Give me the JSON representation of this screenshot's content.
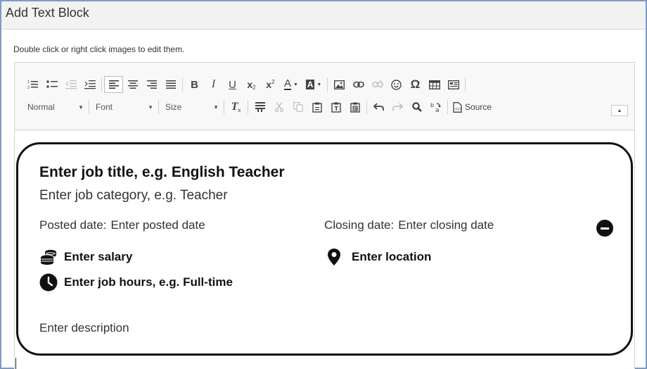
{
  "dialog": {
    "title": "Add Text Block",
    "hint": "Double click or right click images to edit them."
  },
  "toolbar": {
    "row1": [
      {
        "name": "numbered-list-icon",
        "label": "Insert/Remove Numbered List"
      },
      {
        "name": "bulleted-list-icon",
        "label": "Insert/Remove Bulleted List"
      },
      {
        "name": "decrease-indent-icon",
        "label": "Decrease Indent",
        "disabled": true
      },
      {
        "name": "increase-indent-icon",
        "label": "Increase Indent"
      },
      {
        "name": "align-left-icon",
        "label": "Align Left",
        "active": true
      },
      {
        "name": "align-center-icon",
        "label": "Center"
      },
      {
        "name": "align-right-icon",
        "label": "Align Right"
      },
      {
        "name": "justify-icon",
        "label": "Justify"
      },
      {
        "name": "bold-icon",
        "glyph": "B"
      },
      {
        "name": "italic-icon",
        "glyph": "I"
      },
      {
        "name": "underline-icon",
        "glyph": "U"
      },
      {
        "name": "subscript-icon",
        "glyph": "x"
      },
      {
        "name": "superscript-icon",
        "glyph": "x"
      },
      {
        "name": "text-color-icon",
        "glyph": "A"
      },
      {
        "name": "background-color-icon",
        "glyph": "A"
      },
      {
        "name": "image-icon"
      },
      {
        "name": "link-icon"
      },
      {
        "name": "unlink-icon",
        "disabled": true
      },
      {
        "name": "smiley-icon"
      },
      {
        "name": "omega-icon",
        "glyph": "Ω"
      },
      {
        "name": "table-icon"
      },
      {
        "name": "template-icon"
      }
    ],
    "format_combo": "Normal",
    "font_combo": "Font",
    "size_combo": "Size",
    "source_label": "Source",
    "colors": {
      "toolbar_bg": "#f8f8f8",
      "icon": "#444444",
      "icon_disabled": "#c0c0c0",
      "window_border": "#7a9cc6"
    }
  },
  "card": {
    "job_title": "Enter job title, e.g. English Teacher",
    "job_category": "Enter job category, e.g. Teacher",
    "posted_label": "Posted date:",
    "posted_value": "Enter posted date",
    "closing_label": "Closing date:",
    "closing_value": "Enter closing date",
    "salary": "Enter salary",
    "location": "Enter location",
    "hours": "Enter job hours, e.g. Full-time",
    "description": "Enter description",
    "icons": [
      "coins-icon",
      "map-pin-icon",
      "clock-icon",
      "remove-circle-icon"
    ]
  }
}
